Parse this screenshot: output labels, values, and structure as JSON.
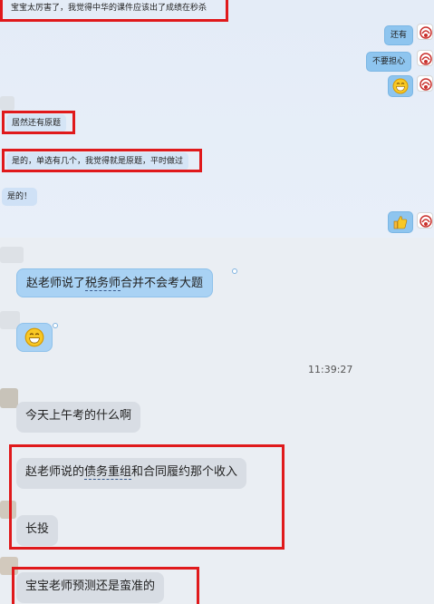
{
  "colors": {
    "highlight_border": "#e0191b",
    "bubble_blue": "#a9d2f4",
    "bubble_gray": "#d8dde4",
    "bubble_small_left": "#cfe1f6",
    "bubble_small_right": "#8ec5ef"
  },
  "top_messages": [
    {
      "side": "left",
      "text": "宝宝太厉害了，我觉得中华的课件应该出了成绩在秒杀"
    },
    {
      "side": "right",
      "text": "还有"
    },
    {
      "side": "right",
      "text": "不要担心"
    },
    {
      "side": "right",
      "icon": "grinning-emoji-icon"
    },
    {
      "side": "left",
      "text": "居然还有原题"
    },
    {
      "side": "left",
      "text": "是的，单选有几个，我觉得就是原题，平时做过"
    },
    {
      "side": "left",
      "text": "是的！"
    },
    {
      "side": "right",
      "icon": "thumbs-up-emoji-icon"
    }
  ],
  "bottom_messages": [
    {
      "text_before": "赵老师说了",
      "text_underlined": "税务师",
      "text_after": "合并不会考大题"
    },
    {
      "icon": "grinning-emoji-icon"
    },
    {
      "text": "今天上午考的什么啊"
    },
    {
      "text_before": "赵老师说的",
      "text_underlined": "债务重组",
      "text_after": "和合同履约那个收入"
    },
    {
      "text": "长投"
    },
    {
      "text": "宝宝老师预测还是蛮准的"
    }
  ],
  "timestamp": "11:39:27"
}
